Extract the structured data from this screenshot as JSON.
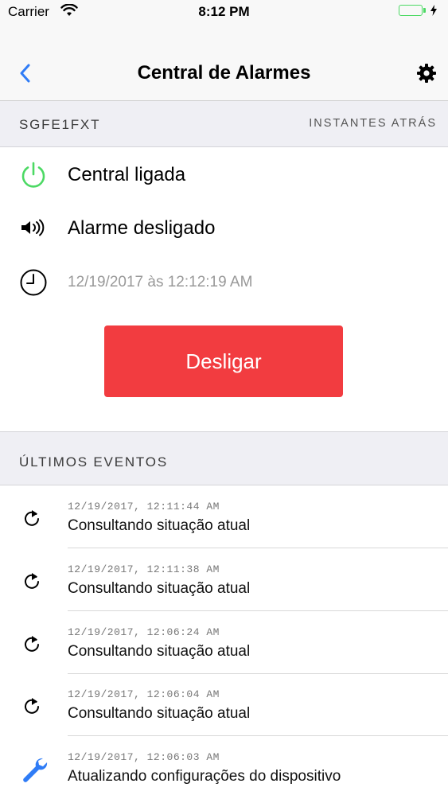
{
  "status_bar": {
    "carrier": "Carrier",
    "time": "8:12 PM"
  },
  "nav": {
    "title": "Central de Alarmes",
    "back_icon": "chevron-left-icon",
    "settings_icon": "gear-icon"
  },
  "device": {
    "id": "SGFE1FXT",
    "updated": "INSTANTES ATRÁS"
  },
  "status": {
    "power_label": "Central ligada",
    "alarm_label": "Alarme desligado",
    "timestamp": "12/19/2017 às 12:12:19 AM"
  },
  "action": {
    "label": "Desligar"
  },
  "events_header": "ÚLTIMOS EVENTOS",
  "events": [
    {
      "time": "12/19/2017, 12:11:44 AM",
      "text": "Consultando situação atual",
      "icon": "refresh-icon"
    },
    {
      "time": "12/19/2017, 12:11:38 AM",
      "text": "Consultando situação atual",
      "icon": "refresh-icon"
    },
    {
      "time": "12/19/2017, 12:06:24 AM",
      "text": "Consultando situação atual",
      "icon": "refresh-icon"
    },
    {
      "time": "12/19/2017, 12:06:04 AM",
      "text": "Consultando situação atual",
      "icon": "refresh-icon"
    },
    {
      "time": "12/19/2017, 12:06:03 AM",
      "text": "Atualizando configurações do dispositivo",
      "icon": "wrench-icon"
    }
  ],
  "colors": {
    "accent": "#2f7cf6",
    "power_on": "#4cd964",
    "danger": "#f23c40"
  }
}
